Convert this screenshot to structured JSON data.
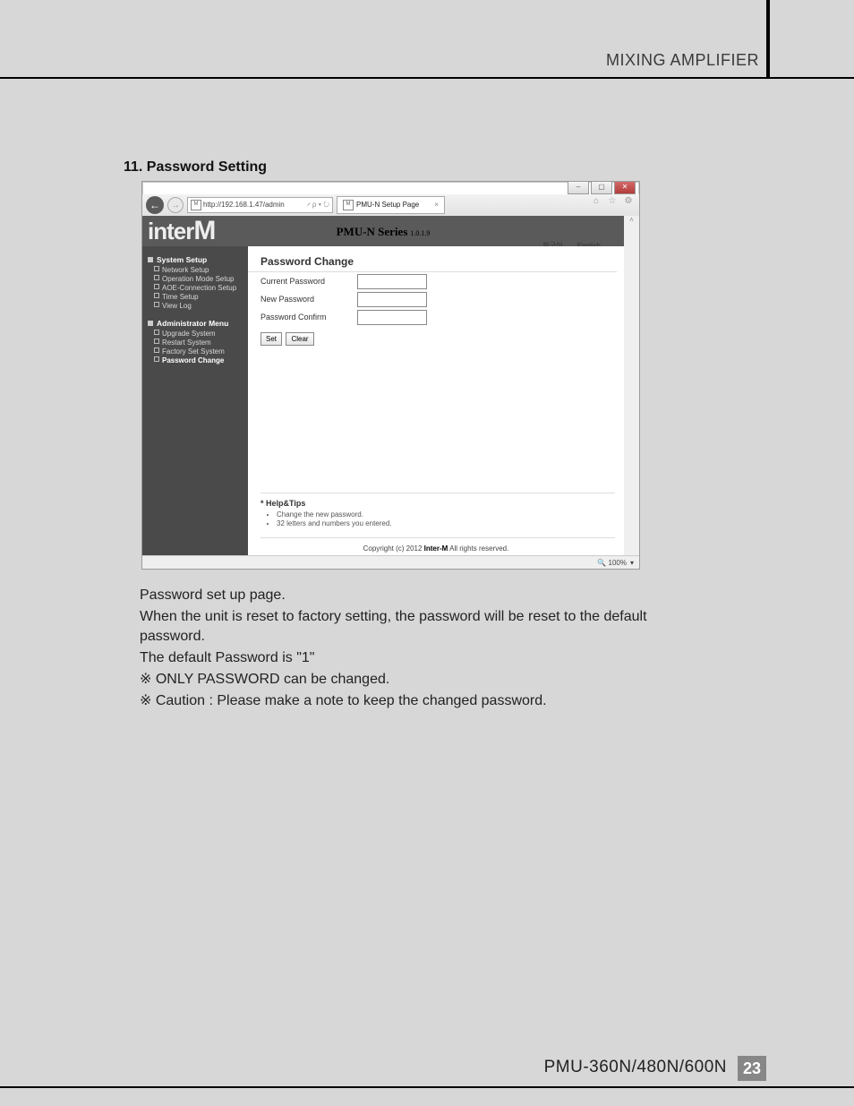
{
  "header": {
    "product_line": "MIXING AMPLIFIER"
  },
  "section": {
    "heading": "11. Password Setting"
  },
  "browser": {
    "window_buttons": {
      "min": "–",
      "max": "▢",
      "close": "✕"
    },
    "back_glyph": "←",
    "fwd_glyph": "→",
    "url": "http://192.168.1.47/admin",
    "search_hint": "𝄍 ρ ▾ ↻",
    "tab_title": "PMU-N Setup Page",
    "tab_close": "×",
    "toolbar_icons": {
      "home": "⌂",
      "star": "☆",
      "gear": "⚙"
    },
    "scroll": {
      "up": "˄",
      "down": "˅"
    },
    "status": {
      "zoom": "🔍 100%",
      "arrow": "▾"
    }
  },
  "page": {
    "logo": "inter",
    "logo_cap": "M",
    "series": "PMU-N Series",
    "version": "1.0.1.9",
    "lang_ko": "한국어",
    "lang_en": "English",
    "sidebar": {
      "group1": "System Setup",
      "items1": [
        "Network Setup",
        "Operation Mode Setup",
        "AOE-Connection Setup",
        "Time Setup",
        "View Log"
      ],
      "group2": "Administrator Menu",
      "items2": [
        "Upgrade System",
        "Restart System",
        "Factory Set System",
        "Password Change"
      ]
    },
    "content": {
      "title": "Password Change",
      "rows": {
        "current": "Current Password",
        "new": "New Password",
        "confirm": "Password Confirm"
      },
      "buttons": {
        "set": "Set",
        "clear": "Clear"
      },
      "help_title": "* Help&Tips",
      "help_items": [
        "Change the new password.",
        "32 letters and numbers you entered."
      ],
      "copyright_pre": "Copyright (c) 2012 ",
      "copyright_brand": "Inter-M",
      "copyright_post": " All rights reserved."
    }
  },
  "body": {
    "l1": "Password set up page.",
    "l2": "When the unit is reset to factory setting, the password will be reset to the default password.",
    "l3": "The default Password is \"1\"",
    "l4": "※ ONLY PASSWORD can be changed.",
    "l5": "※ Caution : Please make a note to keep the changed password."
  },
  "footer": {
    "model": "PMU-360N/480N/600N",
    "page": "23"
  }
}
